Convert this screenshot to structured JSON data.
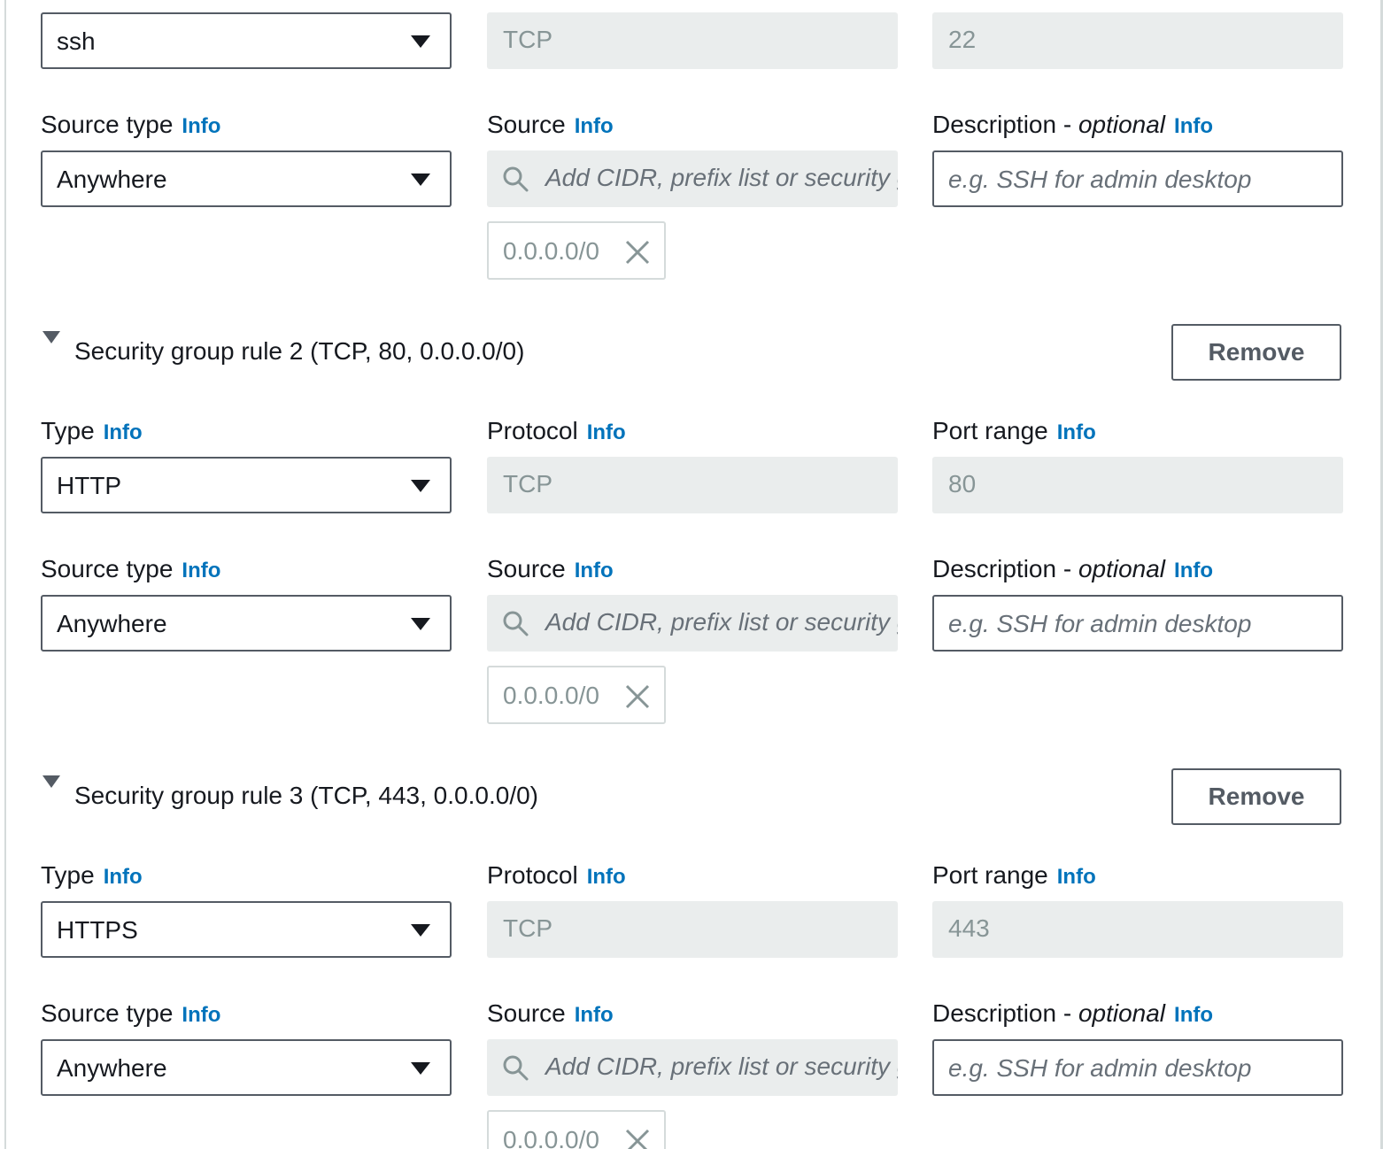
{
  "common": {
    "info_link": "Info",
    "labels": {
      "type": "Type",
      "protocol": "Protocol",
      "port_range": "Port range",
      "source_type": "Source type",
      "source": "Source",
      "description": "Description - ",
      "optional": "optional"
    },
    "source_placeholder": "Add CIDR, prefix list or security group",
    "description_placeholder": "e.g. SSH for admin desktop",
    "remove_label": "Remove"
  },
  "rules": [
    {
      "type": "ssh",
      "protocol": "TCP",
      "port_range": "22",
      "source_type": "Anywhere",
      "source_token": "0.0.0.0/0"
    },
    {
      "title": "Security group rule 2 (TCP, 80, 0.0.0.0/0)",
      "type": "HTTP",
      "protocol": "TCP",
      "port_range": "80",
      "source_type": "Anywhere",
      "source_token": "0.0.0.0/0"
    },
    {
      "title": "Security group rule 3 (TCP, 443, 0.0.0.0/0)",
      "type": "HTTPS",
      "protocol": "TCP",
      "port_range": "443",
      "source_type": "Anywhere",
      "source_token": "0.0.0.0/0"
    }
  ]
}
